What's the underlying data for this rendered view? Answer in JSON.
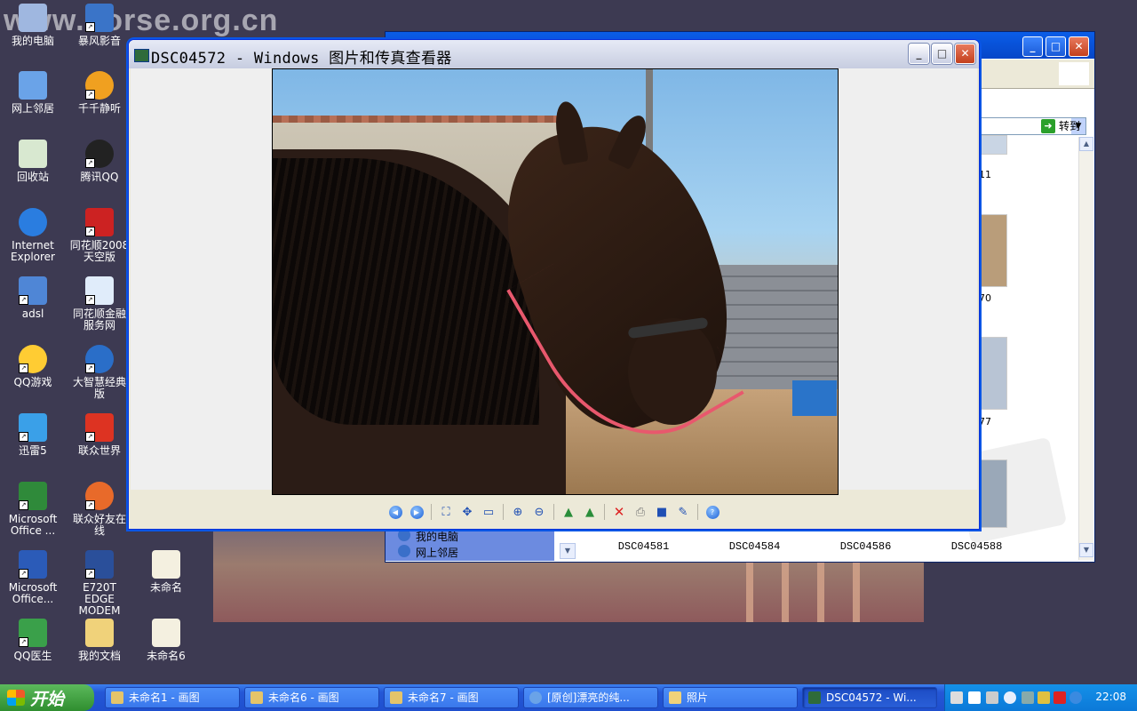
{
  "watermark": "www.horse.org.cn",
  "desktop_icons": [
    {
      "label": "我的电脑"
    },
    {
      "label": "暴风影音"
    },
    {
      "label": "网上邻居"
    },
    {
      "label": "千千静听"
    },
    {
      "label": "回收站"
    },
    {
      "label": "腾讯QQ"
    },
    {
      "label": "Internet Explorer"
    },
    {
      "label": "同花顺2008 天空版"
    },
    {
      "label": "adsl"
    },
    {
      "label": "同花顺金融 服务网"
    },
    {
      "label": "QQ游戏"
    },
    {
      "label": "大智慧经典 版"
    },
    {
      "label": "迅雷5"
    },
    {
      "label": "联众世界"
    },
    {
      "label": "Microsoft Office ..."
    },
    {
      "label": "联众好友在 线"
    },
    {
      "label": "Microsoft Office..."
    },
    {
      "label": "E720T EDGE MODEM"
    },
    {
      "label": "未命名"
    },
    {
      "label": "QQ医生"
    },
    {
      "label": "我的文档"
    },
    {
      "label": "未命名6"
    }
  ],
  "explorer": {
    "goto_label": "转到",
    "left_pane": [
      "我的电脑",
      "网上邻居"
    ],
    "thumb_side_labels": [
      "11",
      "70",
      "77"
    ],
    "thumb_names": [
      "DSC04581",
      "DSC04584",
      "DSC04586",
      "DSC04588"
    ]
  },
  "viewer": {
    "title": "DSC04572 - Windows 图片和传真查看器",
    "toolbar": [
      {
        "name": "previous-image",
        "icon": "prev-icon"
      },
      {
        "name": "next-image",
        "icon": "next-icon"
      },
      {
        "name": "best-fit",
        "icon": "best-fit-icon"
      },
      {
        "name": "actual-size",
        "icon": "actual-size-icon"
      },
      {
        "name": "slideshow",
        "icon": "slideshow-icon"
      },
      {
        "name": "zoom-in",
        "icon": "zoom-in-icon"
      },
      {
        "name": "zoom-out",
        "icon": "zoom-out-icon"
      },
      {
        "name": "rotate-clockwise",
        "icon": "rotate-cw-icon"
      },
      {
        "name": "rotate-counterclockwise",
        "icon": "rotate-ccw-icon"
      },
      {
        "name": "delete",
        "icon": "delete-icon"
      },
      {
        "name": "print",
        "icon": "print-icon"
      },
      {
        "name": "copy-to",
        "icon": "save-icon"
      },
      {
        "name": "open-for-editing",
        "icon": "edit-icon"
      },
      {
        "name": "help",
        "icon": "help-icon"
      }
    ]
  },
  "taskbar": {
    "start_label": "开始",
    "tasks": [
      {
        "label": "未命名1 - 画图"
      },
      {
        "label": "未命名6 - 画图"
      },
      {
        "label": "未命名7 - 画图"
      },
      {
        "label": "[原创]漂亮的纯..."
      },
      {
        "label": "照片"
      },
      {
        "label": "DSC04572 - Wi..."
      }
    ],
    "clock": "22:08"
  },
  "colors": {
    "desktop_bg": "#3d3a52",
    "taskbar_blue": "#2457d6",
    "start_green": "#2f8e2f",
    "tray_blue": "#0c79d8"
  }
}
